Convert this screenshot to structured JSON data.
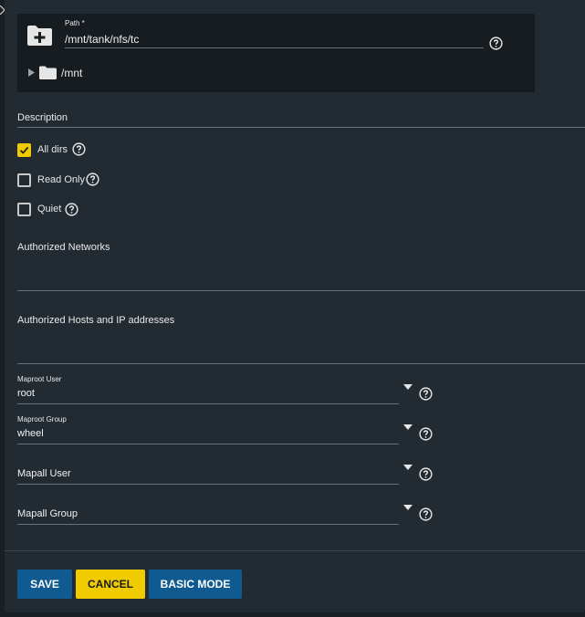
{
  "explorer": {
    "path_label": "Path *",
    "path_value": "/mnt/tank/nfs/tc",
    "tree_root": "/mnt",
    "icons": {
      "add": "folder-add-icon",
      "tree": "folder-icon",
      "expand": "caret-right-icon"
    }
  },
  "description": {
    "label": "Description",
    "value": ""
  },
  "options": {
    "all_dirs": {
      "label": "All dirs",
      "checked": true
    },
    "read_only": {
      "label": "Read Only",
      "checked": false
    },
    "quiet": {
      "label": "Quiet",
      "checked": false
    }
  },
  "networks": {
    "label": "Authorized Networks",
    "value": ""
  },
  "hosts": {
    "label": "Authorized Hosts and IP addresses",
    "value": ""
  },
  "maproot_user": {
    "label": "Maproot User",
    "value": "root"
  },
  "maproot_group": {
    "label": "Maproot Group",
    "value": "wheel"
  },
  "mapall_user": {
    "label": "Mapall User",
    "value": ""
  },
  "mapall_group": {
    "label": "Mapall Group",
    "value": ""
  },
  "actions": {
    "save": "SAVE",
    "cancel": "CANCEL",
    "basic_mode": "BASIC MODE"
  },
  "colors": {
    "panel": "#232b32",
    "explorer": "#171c21",
    "primary": "#0f5a91",
    "accent": "#f0cb00",
    "text": "#e8e8e8"
  }
}
